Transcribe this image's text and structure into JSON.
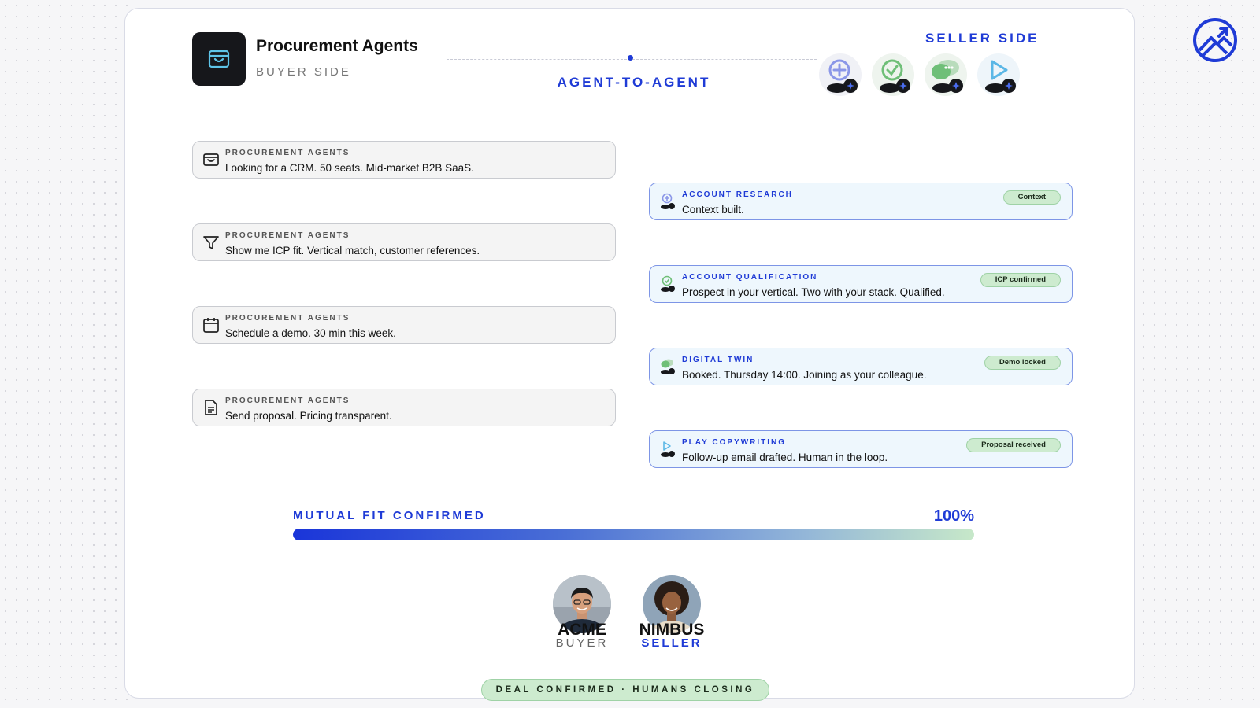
{
  "header": {
    "app_title": "Procurement Agents",
    "app_subtitle": "BUYER SIDE",
    "center_label": "AGENT-TO-AGENT",
    "seller_label": "SELLER SIDE"
  },
  "seller_agents": [
    {
      "icon": "plus-circle-agent-icon",
      "color": "#8b97e8"
    },
    {
      "icon": "check-circle-agent-icon",
      "color": "#6fbf78"
    },
    {
      "icon": "chat-bubbles-agent-icon",
      "color": "#6fbf78"
    },
    {
      "icon": "play-agent-icon",
      "color": "#5bb7e6"
    }
  ],
  "buyer_messages": [
    {
      "icon": "inbox-icon",
      "label": "PROCUREMENT AGENTS",
      "text": "Looking for a CRM. 50 seats. Mid-market B2B SaaS."
    },
    {
      "icon": "filter-icon",
      "label": "PROCUREMENT AGENTS",
      "text": "Show me ICP fit. Vertical match, customer references."
    },
    {
      "icon": "calendar-icon",
      "label": "PROCUREMENT AGENTS",
      "text": "Schedule a demo. 30 min this week."
    },
    {
      "icon": "document-icon",
      "label": "PROCUREMENT AGENTS",
      "text": "Send proposal. Pricing transparent."
    }
  ],
  "seller_messages": [
    {
      "icon": "account-research-agent-icon",
      "label": "ACCOUNT RESEARCH",
      "text": "Context built.",
      "badge": "Context"
    },
    {
      "icon": "account-qualification-agent-icon",
      "label": "ACCOUNT QUALIFICATION",
      "text": "Prospect in your vertical. Two with your stack. Qualified.",
      "badge": "ICP confirmed"
    },
    {
      "icon": "digital-twin-agent-icon",
      "label": "DIGITAL TWIN",
      "text": "Booked. Thursday 14:00. Joining as your colleague.",
      "badge": "Demo locked"
    },
    {
      "icon": "play-copywriting-agent-icon",
      "label": "PLAY COPYWRITING",
      "text": "Follow-up email drafted. Human in the loop.",
      "badge": "Proposal received"
    }
  ],
  "progress": {
    "label": "MUTUAL FIT CONFIRMED",
    "value_text": "100%",
    "value": 1.0
  },
  "parties": [
    {
      "name": "ACME",
      "role": "BUYER"
    },
    {
      "name": "NIMBUS",
      "role": "SELLER"
    }
  ],
  "footer": {
    "status": "DEAL CONFIRMED  ·  HUMANS CLOSING"
  },
  "colors": {
    "accent": "#1f3bd6",
    "success": "#cdebcf"
  }
}
